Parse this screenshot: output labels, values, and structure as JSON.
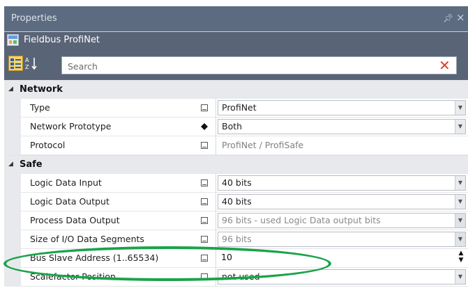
{
  "window": {
    "title": "Properties",
    "pin_icon": "pin-icon",
    "close_icon": "close-icon"
  },
  "object": {
    "name": "Fieldbus ProfiNet",
    "icon": "fieldbus-icon"
  },
  "toolbar": {
    "categorized_icon": "categorized-view-icon",
    "alphabetical_icon": "sort-alphabetical-icon",
    "search_placeholder": "Search",
    "search_value": "",
    "clear_icon": "clear-search-icon",
    "clear_color": "#d9402c"
  },
  "categories": [
    {
      "name": "Network",
      "rows": [
        {
          "name": "Type",
          "flag": "square",
          "value": "ProfiNet",
          "editor": "combo"
        },
        {
          "name": "Network Prototype",
          "flag": "diamond",
          "value": "Both",
          "editor": "combo"
        },
        {
          "name": "Protocol",
          "flag": "square",
          "value": "ProfiNet / ProfiSafe",
          "editor": "readonly"
        }
      ]
    },
    {
      "name": "Safe",
      "rows": [
        {
          "name": "Logic Data Input",
          "flag": "square",
          "value": "40 bits",
          "editor": "combo"
        },
        {
          "name": "Logic Data Output",
          "flag": "square",
          "value": "40 bits",
          "editor": "combo"
        },
        {
          "name": "Process Data Output",
          "flag": "square",
          "value": "96 bits - used Logic Data output bits",
          "editor": "combo-disabled"
        },
        {
          "name": "Size of I/O Data Segments",
          "flag": "square",
          "value": "96 bits",
          "editor": "combo-disabled"
        },
        {
          "name": "Bus Slave Address (1..65534)",
          "flag": "square",
          "value": "10",
          "editor": "spin"
        },
        {
          "name": "Scalefactor Position",
          "flag": "square",
          "value": "not used",
          "editor": "combo"
        }
      ]
    }
  ],
  "highlight": {
    "target": "Bus Slave Address (1..65534)",
    "color": "#1aa34a"
  },
  "colors": {
    "title_bar": "#5d6b81",
    "toolbar": "#5a6477",
    "category_bg": "#e7e9ec"
  }
}
